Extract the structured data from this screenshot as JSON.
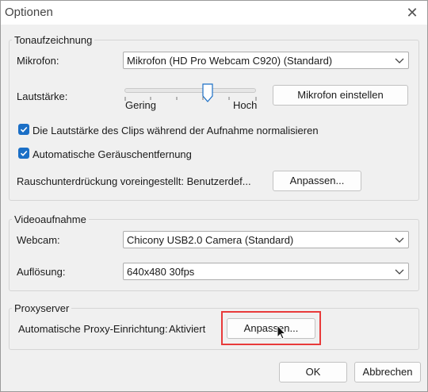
{
  "window": {
    "title": "Optionen",
    "close_icon": "close-icon"
  },
  "recording": {
    "legend": "Tonaufzeichnung",
    "mic_label": "Mikrofon:",
    "mic_value": "Mikrofon (HD Pro Webcam C920) (Standard)",
    "volume_label": "Lautstärke:",
    "volume_level": 0.63,
    "volume_low": "Gering",
    "volume_high": "Hoch",
    "mic_settings_button": "Mikrofon einstellen",
    "normalize_label": "Die Lautstärke des Clips während der Aufnahme normalisieren",
    "normalize_checked": true,
    "noise_removal_label": "Automatische Geräuschentfernung",
    "noise_removal_checked": true,
    "noise_preset_label": "Rauschunterdrückung voreingestellt: Benutzerdef...",
    "noise_adjust_button": "Anpassen..."
  },
  "video": {
    "legend": "Videoaufnahme",
    "webcam_label": "Webcam:",
    "webcam_value": "Chicony USB2.0 Camera (Standard)",
    "resolution_label": "Auflösung:",
    "resolution_value": "640x480 30fps"
  },
  "proxy": {
    "legend": "Proxyserver",
    "auto_label": "Automatische Proxy-Einrichtung:",
    "auto_value": "Aktiviert",
    "adjust_button": "Anpassen..."
  },
  "footer": {
    "ok_button": "OK",
    "cancel_button": "Abbrechen"
  },
  "colors": {
    "accent": "#1b6fc6",
    "highlight": "#e83a3a"
  }
}
